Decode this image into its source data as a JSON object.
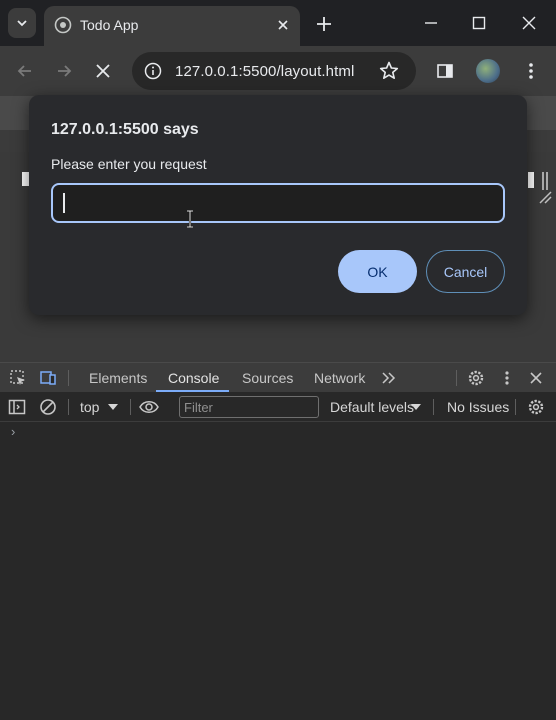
{
  "browser": {
    "tab_title": "Todo App",
    "url": "127.0.0.1:5500/layout.html"
  },
  "dialog": {
    "title": "127.0.0.1:5500 says",
    "message": "Please enter you request",
    "input_value": "",
    "ok_label": "OK",
    "cancel_label": "Cancel"
  },
  "devtools": {
    "tabs": [
      "Elements",
      "Console",
      "Sources",
      "Network"
    ],
    "active_tab": "Console",
    "context": "top",
    "filter_placeholder": "Filter",
    "levels_label": "Default levels",
    "issues_label": "No Issues",
    "prompt_symbol": "›"
  },
  "colors": {
    "accent": "#a8c7fa",
    "ok_text": "#062e6f",
    "tab_underline": "#7cacf8"
  }
}
